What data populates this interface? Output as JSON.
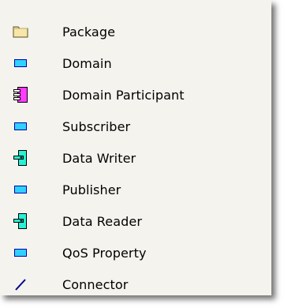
{
  "toolbox": {
    "items": [
      {
        "label": "Package",
        "icon": "folder-icon"
      },
      {
        "label": "Domain",
        "icon": "rectangle-icon"
      },
      {
        "label": "Domain Participant",
        "icon": "participant-icon"
      },
      {
        "label": "Subscriber",
        "icon": "rectangle-icon"
      },
      {
        "label": "Data Writer",
        "icon": "component-icon"
      },
      {
        "label": "Publisher",
        "icon": "rectangle-icon"
      },
      {
        "label": "Data Reader",
        "icon": "component-icon"
      },
      {
        "label": "QoS Property",
        "icon": "rectangle-icon"
      },
      {
        "label": "Connector",
        "icon": "connector-line-icon"
      }
    ]
  },
  "colors": {
    "panel_bg": "#f4f3ee",
    "rect_fill": "#2fd2ff",
    "rect_border": "#0000aa",
    "component_fill": "#28f0d4",
    "participant_fill": "#ff3cff",
    "folder_fill": "#f7e6a8",
    "connector": "#00008b"
  }
}
